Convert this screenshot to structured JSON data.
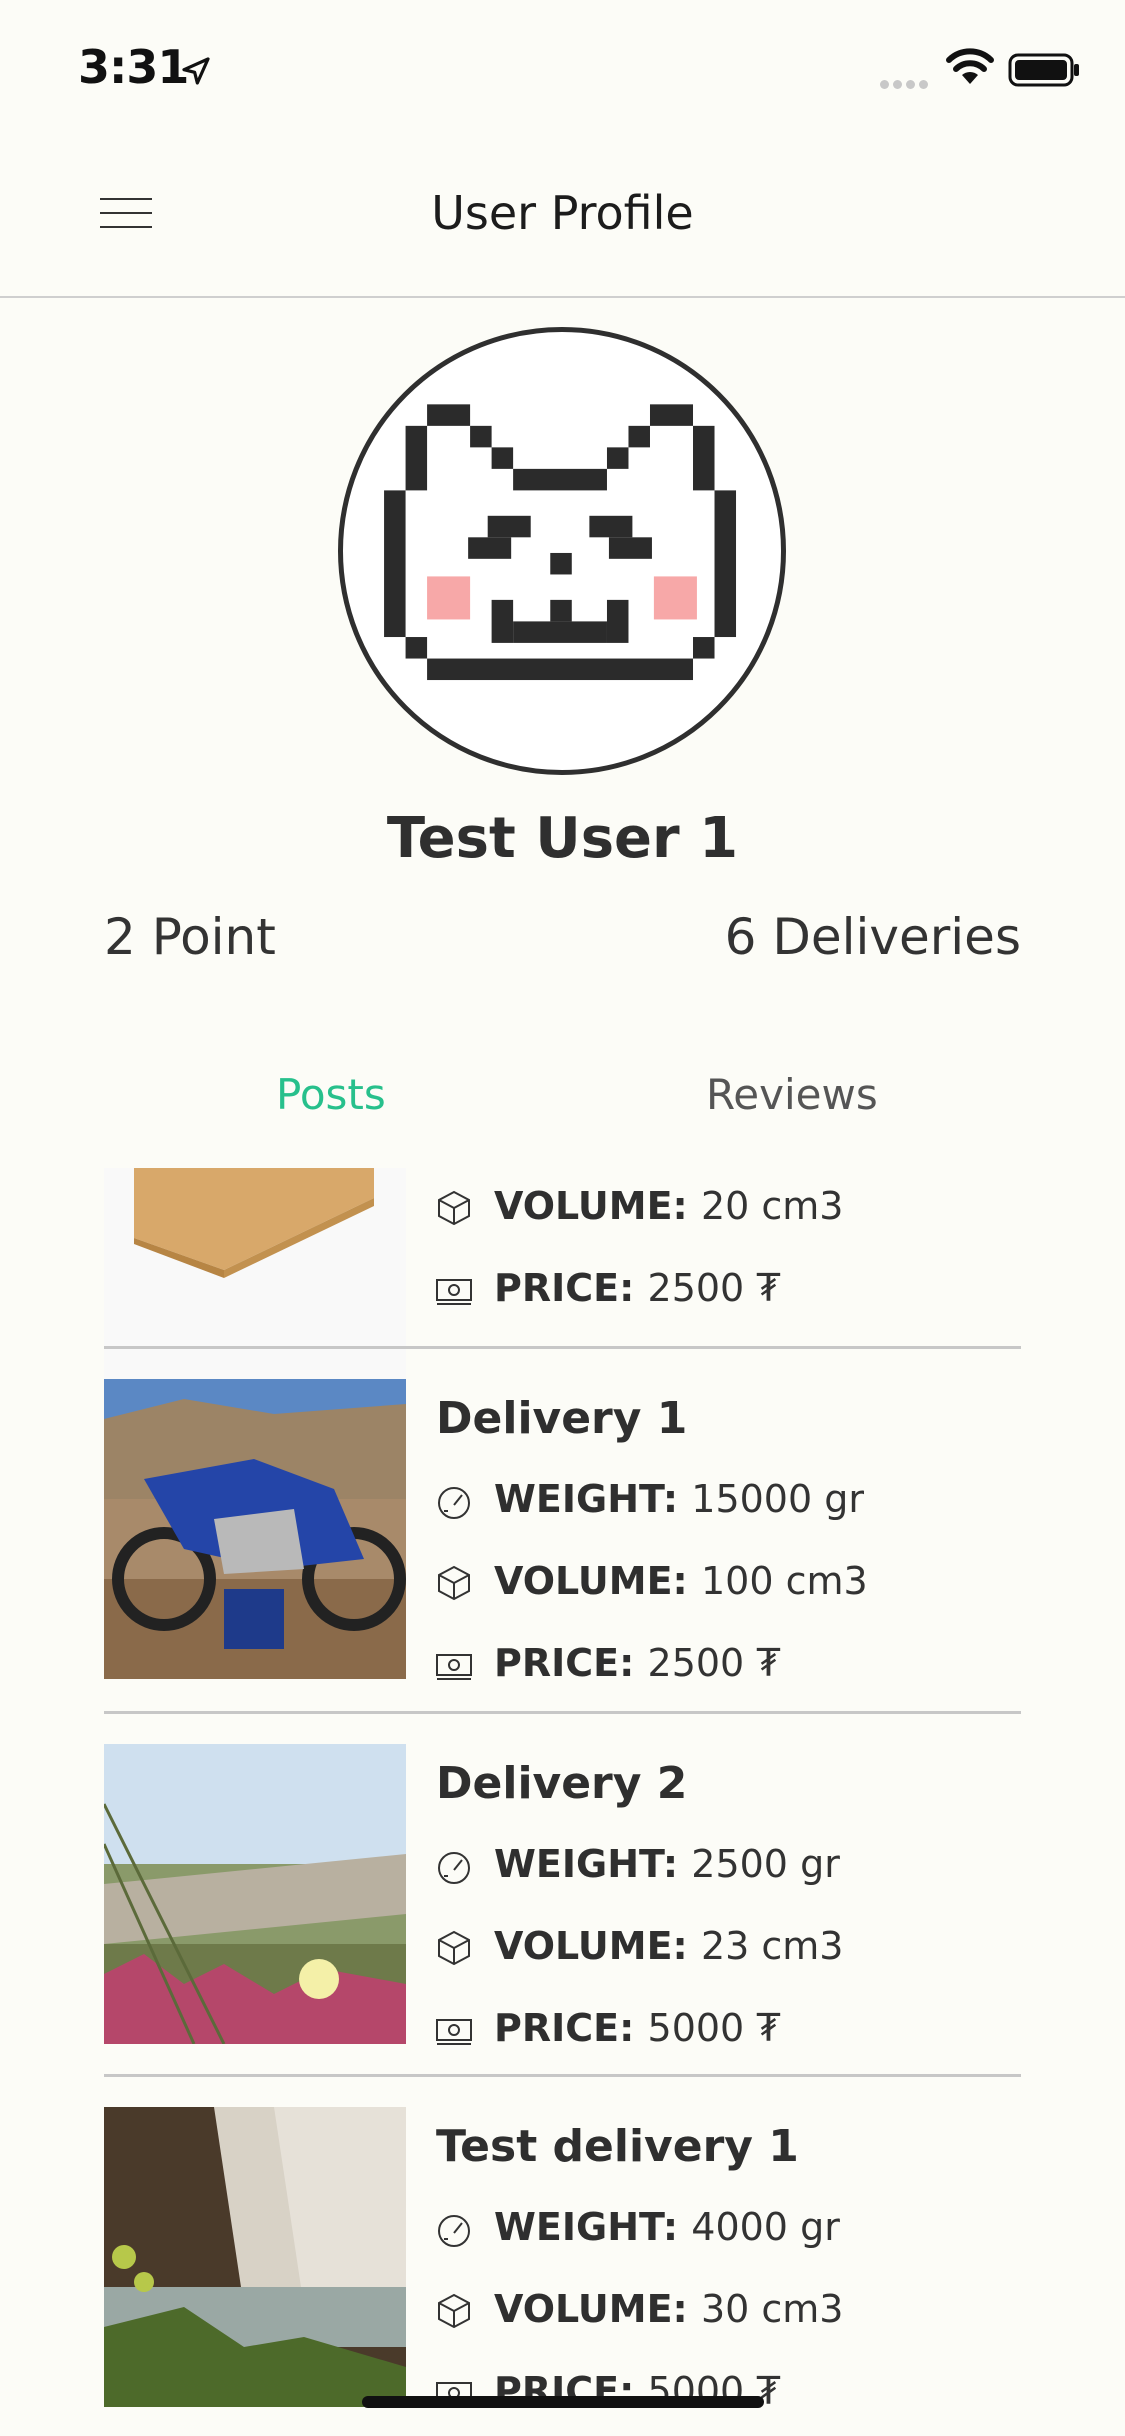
{
  "status_bar": {
    "time": "3:31"
  },
  "header": {
    "title": "User Profile"
  },
  "profile": {
    "name": "Test User 1",
    "points": "2 Point",
    "deliveries": "6 Deliveries"
  },
  "tabs": [
    {
      "label": "Posts",
      "active": true
    },
    {
      "label": "Reviews",
      "active": false
    }
  ],
  "posts": [
    {
      "title": "",
      "thumbnail": "cardboard-box-image",
      "rows": [
        {
          "icon": "cube-icon",
          "label": "VOLUME:",
          "value": "20 cm3"
        },
        {
          "icon": "banknote-icon",
          "label": "PRICE:",
          "value": "2500 ₮"
        }
      ]
    },
    {
      "title": "Delivery 1",
      "thumbnail": "motorcycle-image",
      "rows": [
        {
          "icon": "gauge-icon",
          "label": "WEIGHT:",
          "value": "15000 gr"
        },
        {
          "icon": "cube-icon",
          "label": "VOLUME:",
          "value": "100 cm3"
        },
        {
          "icon": "banknote-icon",
          "label": "PRICE:",
          "value": "2500 ₮"
        }
      ]
    },
    {
      "title": "Delivery 2",
      "thumbnail": "flower-image",
      "rows": [
        {
          "icon": "gauge-icon",
          "label": "WEIGHT:",
          "value": "2500 gr"
        },
        {
          "icon": "cube-icon",
          "label": "VOLUME:",
          "value": "23 cm3"
        },
        {
          "icon": "banknote-icon",
          "label": "PRICE:",
          "value": "5000 ₮"
        }
      ]
    },
    {
      "title": "Test delivery 1",
      "thumbnail": "waterfall-image",
      "rows": [
        {
          "icon": "gauge-icon",
          "label": "WEIGHT:",
          "value": "4000 gr"
        },
        {
          "icon": "cube-icon",
          "label": "VOLUME:",
          "value": "30 cm3"
        },
        {
          "icon": "banknote-icon",
          "label": "PRICE:",
          "value": "5000 ₮"
        }
      ]
    }
  ],
  "colors": {
    "background": "#fcfcf7",
    "accent": "#27c08c",
    "text": "#2f2f2f",
    "blush": "#f7a8a8"
  }
}
